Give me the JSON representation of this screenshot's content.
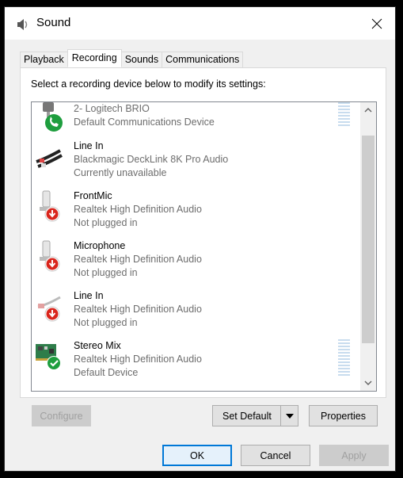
{
  "window": {
    "title": "Sound",
    "icon": "speaker-icon"
  },
  "tabs": [
    {
      "label": "Playback",
      "active": false
    },
    {
      "label": "Recording",
      "active": true
    },
    {
      "label": "Sounds",
      "active": false
    },
    {
      "label": "Communications",
      "active": false
    }
  ],
  "instruction": "Select a recording device below to modify its settings:",
  "devices": [
    {
      "name": "2- Logitech BRIO",
      "line2": "Default Communications Device",
      "line3": "",
      "icon": "webcam-icon",
      "badge": "phone-badge-icon",
      "enabled": false,
      "meter": true
    },
    {
      "name": "Line In",
      "line2": "Blackmagic DeckLink 8K Pro Audio",
      "line3": "Currently unavailable",
      "icon": "rca-cable-icon",
      "badge": "",
      "enabled": true,
      "meter": false
    },
    {
      "name": "FrontMic",
      "line2": "Realtek High Definition Audio",
      "line3": "Not plugged in",
      "icon": "microphone-jack-icon",
      "badge": "unplugged-badge-icon",
      "enabled": true,
      "meter": false
    },
    {
      "name": "Microphone",
      "line2": "Realtek High Definition Audio",
      "line3": "Not plugged in",
      "icon": "microphone-jack-icon",
      "badge": "unplugged-badge-icon",
      "enabled": true,
      "meter": false
    },
    {
      "name": "Line In",
      "line2": "Realtek High Definition Audio",
      "line3": "Not plugged in",
      "icon": "line-in-cable-icon",
      "badge": "unplugged-badge-icon",
      "enabled": true,
      "meter": false
    },
    {
      "name": "Stereo Mix",
      "line2": "Realtek High Definition Audio",
      "line3": "Default Device",
      "icon": "sound-card-icon",
      "badge": "default-check-badge-icon",
      "enabled": true,
      "meter": true
    }
  ],
  "buttons": {
    "configure": "Configure",
    "set_default": "Set Default",
    "properties": "Properties",
    "ok": "OK",
    "cancel": "Cancel",
    "apply": "Apply"
  },
  "colors": {
    "accent": "#0078d7",
    "badge_green": "#1e9e3e",
    "badge_red": "#d9251c",
    "disabled_text": "#a0a0a0"
  }
}
